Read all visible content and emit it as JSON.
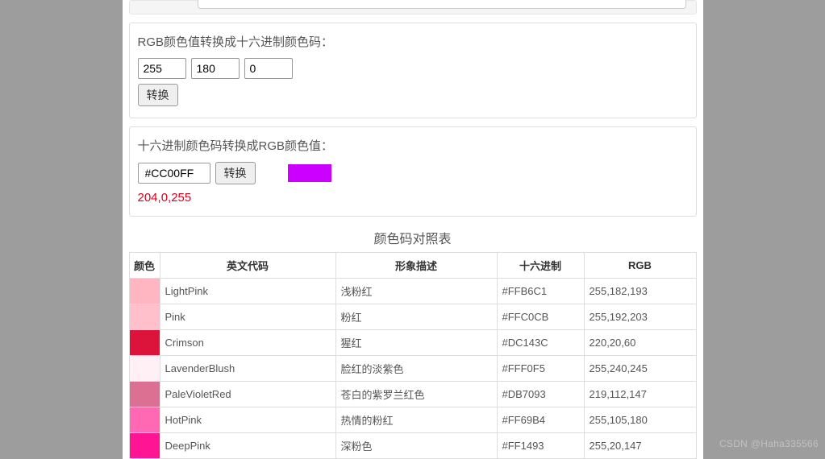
{
  "rgb_to_hex": {
    "title": "RGB颜色值转换成十六进制颜色码：",
    "r": "255",
    "g": "180",
    "b": "0",
    "convert_label": "转换"
  },
  "hex_to_rgb": {
    "title": "十六进制颜色码转换成RGB颜色值：",
    "hex_value": "#CC00FF",
    "convert_label": "转换",
    "swatch_color": "#CC00FF",
    "result": "204,0,255"
  },
  "table": {
    "title": "颜色码对照表",
    "headers": {
      "color": "颜色",
      "en": "英文代码",
      "desc": "形象描述",
      "hex": "十六进制",
      "rgb": "RGB"
    },
    "rows": [
      {
        "swatch": "#FFB6C1",
        "en": "LightPink",
        "desc": "浅粉红",
        "hex": "#FFB6C1",
        "rgb": "255,182,193"
      },
      {
        "swatch": "#FFC0CB",
        "en": "Pink",
        "desc": "粉红",
        "hex": "#FFC0CB",
        "rgb": "255,192,203"
      },
      {
        "swatch": "#DC143C",
        "en": "Crimson",
        "desc": "猩红",
        "hex": "#DC143C",
        "rgb": "220,20,60"
      },
      {
        "swatch": "#FFF0F5",
        "en": "LavenderBlush",
        "desc": "脸红的淡紫色",
        "hex": "#FFF0F5",
        "rgb": "255,240,245"
      },
      {
        "swatch": "#DB7093",
        "en": "PaleVioletRed",
        "desc": "苍白的紫罗兰红色",
        "hex": "#DB7093",
        "rgb": "219,112,147"
      },
      {
        "swatch": "#FF69B4",
        "en": "HotPink",
        "desc": "热情的粉红",
        "hex": "#FF69B4",
        "rgb": "255,105,180"
      },
      {
        "swatch": "#FF1493",
        "en": "DeepPink",
        "desc": "深粉色",
        "hex": "#FF1493",
        "rgb": "255,20,147"
      }
    ]
  },
  "watermark": "CSDN @Haha335566"
}
